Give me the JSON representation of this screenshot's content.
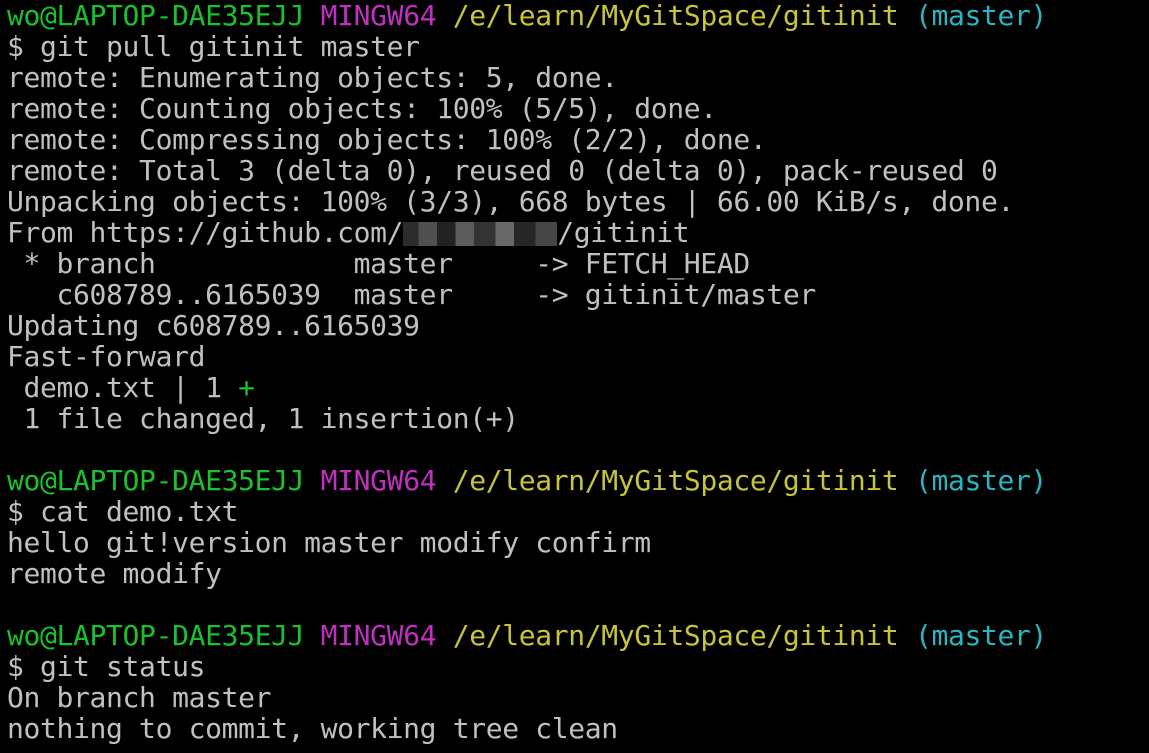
{
  "colors": {
    "background": "#000000",
    "text": "#c0c0c0",
    "user_host": "#19c22b",
    "mingw": "#c02fc0",
    "path": "#c7c33a",
    "branch": "#2ab5c3",
    "plus": "#1fbf2d"
  },
  "prompt": {
    "user_host": "wo@LAPTOP-DAE35EJJ",
    "env": "MINGW64",
    "path": "/e/learn/MyGitSpace/gitinit",
    "branch": "(master)"
  },
  "block1": {
    "command": "$ git pull gitinit master",
    "out1": "remote: Enumerating objects: 5, done.",
    "out2": "remote: Counting objects: 100% (5/5), done.",
    "out3": "remote: Compressing objects: 100% (2/2), done.",
    "out4": "remote: Total 3 (delta 0), reused 0 (delta 0), pack-reused 0",
    "out5": "Unpacking objects: 100% (3/3), 668 bytes | 66.00 KiB/s, done.",
    "from_prefix": "From https://github.com/",
    "from_suffix": "/gitinit",
    "out7": " * branch            master     -> FETCH_HEAD",
    "out8": "   c608789..6165039  master     -> gitinit/master",
    "out9": "Updating c608789..6165039",
    "out10": "Fast-forward",
    "diff_file": " demo.txt | 1 ",
    "diff_plus": "+",
    "out12": " 1 file changed, 1 insertion(+)"
  },
  "block2": {
    "command": "$ cat demo.txt",
    "out1": "hello git!version master modify confirm",
    "out2": "remote modify"
  },
  "block3": {
    "command": "$ git status",
    "out1": "On branch master",
    "out2": "nothing to commit, working tree clean"
  }
}
